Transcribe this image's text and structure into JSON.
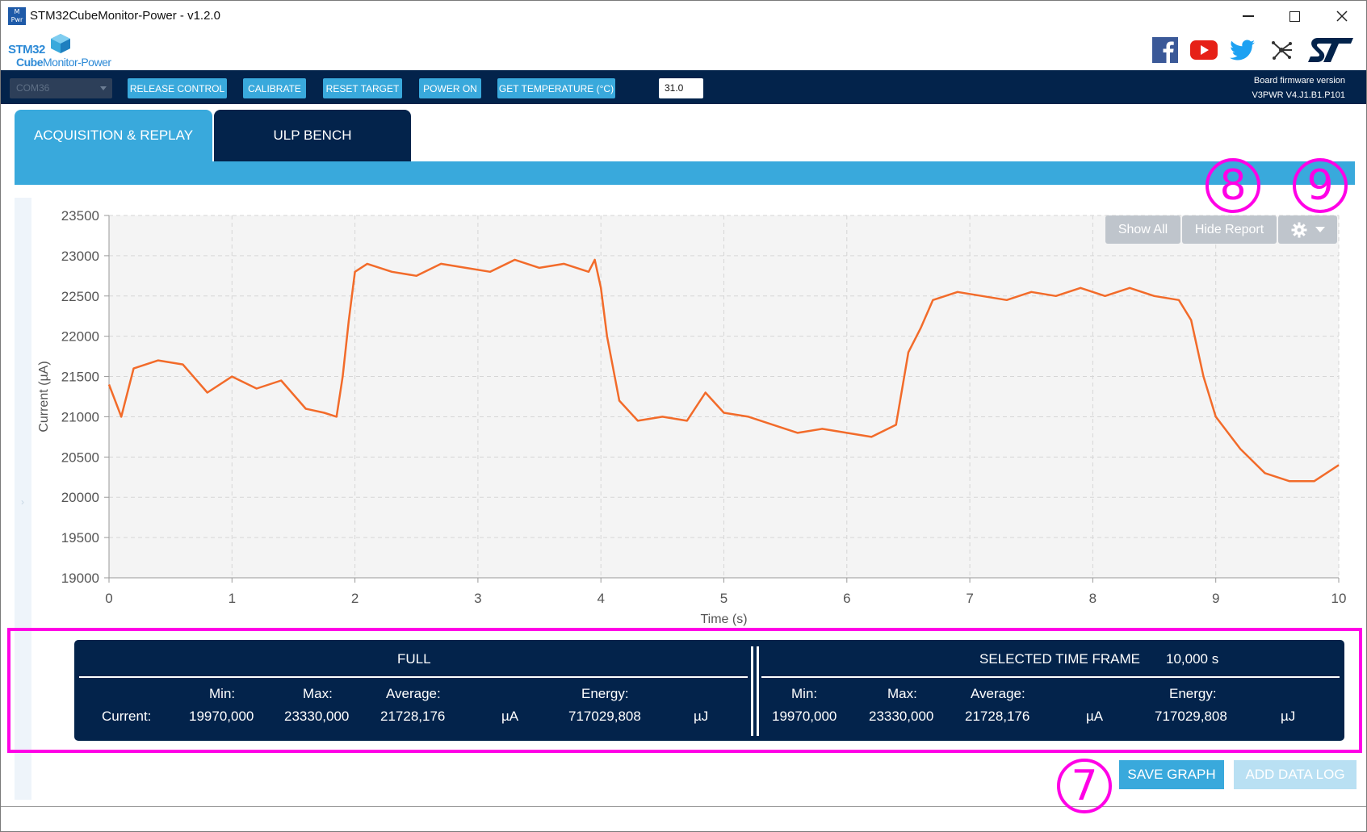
{
  "window": {
    "title": "STM32CubeMonitor-Power - v1.2.0",
    "icon_text": "M\nPwr"
  },
  "header": {
    "logo_stm": "STM32",
    "logo_cube": "Cube",
    "logo_monitor": "Monitor-Power",
    "social_icons": [
      "facebook-icon",
      "youtube-icon",
      "twitter-icon",
      "network-icon",
      "st-logo"
    ]
  },
  "toolbar": {
    "com_port": "COM36",
    "release_control": "RELEASE CONTROL",
    "calibrate": "CALIBRATE",
    "reset_target": "RESET TARGET",
    "power_on": "POWER ON",
    "get_temperature": "GET TEMPERATURE (°C)",
    "temperature_value": "31.0",
    "fw_label": "Board firmware version",
    "fw_value": "V3PWR V4.J1.B1.P101"
  },
  "tabs": [
    {
      "label": "ACQUISITION & REPLAY",
      "active": true
    },
    {
      "label": "ULP BENCH",
      "active": false
    }
  ],
  "chart_controls": {
    "show_all": "Show All",
    "hide_report": "Hide Report"
  },
  "annotations": {
    "a7": "7",
    "a8": "8",
    "a9": "9"
  },
  "chart_data": {
    "type": "line",
    "xlabel": "Time (s)",
    "ylabel": "Current (µA)",
    "xlim": [
      0,
      10
    ],
    "ylim": [
      19000,
      23500
    ],
    "xticks": [
      "0",
      "1",
      "2",
      "3",
      "4",
      "5",
      "6",
      "7",
      "8",
      "9",
      "10"
    ],
    "yticks": [
      "19000",
      "19500",
      "20000",
      "20500",
      "21000",
      "21500",
      "22000",
      "22500",
      "23000",
      "23500"
    ],
    "grid": true,
    "color": "#f26b2a",
    "x": [
      0,
      0.1,
      0.2,
      0.4,
      0.6,
      0.8,
      1.0,
      1.2,
      1.4,
      1.6,
      1.75,
      1.85,
      1.9,
      1.95,
      2.0,
      2.1,
      2.3,
      2.5,
      2.7,
      2.9,
      3.1,
      3.3,
      3.5,
      3.7,
      3.9,
      3.95,
      4.0,
      4.05,
      4.15,
      4.3,
      4.5,
      4.7,
      4.85,
      5.0,
      5.2,
      5.4,
      5.6,
      5.8,
      6.0,
      6.2,
      6.4,
      6.5,
      6.6,
      6.7,
      6.9,
      7.1,
      7.3,
      7.5,
      7.7,
      7.9,
      8.1,
      8.3,
      8.5,
      8.7,
      8.8,
      8.9,
      9.0,
      9.2,
      9.4,
      9.6,
      9.8,
      10.0
    ],
    "values": [
      21400,
      21000,
      21600,
      21700,
      21650,
      21300,
      21500,
      21350,
      21450,
      21100,
      21050,
      21000,
      21500,
      22200,
      22800,
      22900,
      22800,
      22750,
      22900,
      22850,
      22800,
      22950,
      22850,
      22900,
      22800,
      22950,
      22600,
      22000,
      21200,
      20950,
      21000,
      20950,
      21300,
      21050,
      21000,
      20900,
      20800,
      20850,
      20800,
      20750,
      20900,
      21800,
      22100,
      22450,
      22550,
      22500,
      22450,
      22550,
      22500,
      22600,
      22500,
      22600,
      22500,
      22450,
      22200,
      21500,
      21000,
      20600,
      20300,
      20200,
      20200,
      20400
    ]
  },
  "report": {
    "full_title": "FULL",
    "selected_title": "SELECTED TIME FRAME",
    "selected_duration": "10,000 s",
    "min_label": "Min:",
    "max_label": "Max:",
    "avg_label": "Average:",
    "energy_label": "Energy:",
    "current_label": "Current:",
    "full": {
      "min": "19970,000",
      "max": "23330,000",
      "avg": "21728,176",
      "unit": "µA",
      "energy": "717029,808",
      "energy_unit": "µJ"
    },
    "selected": {
      "min": "19970,000",
      "max": "23330,000",
      "avg": "21728,176",
      "unit": "µA",
      "energy": "717029,808",
      "energy_unit": "µJ"
    }
  },
  "bottom": {
    "save_graph": "SAVE GRAPH",
    "add_data_log": "ADD DATA LOG"
  }
}
